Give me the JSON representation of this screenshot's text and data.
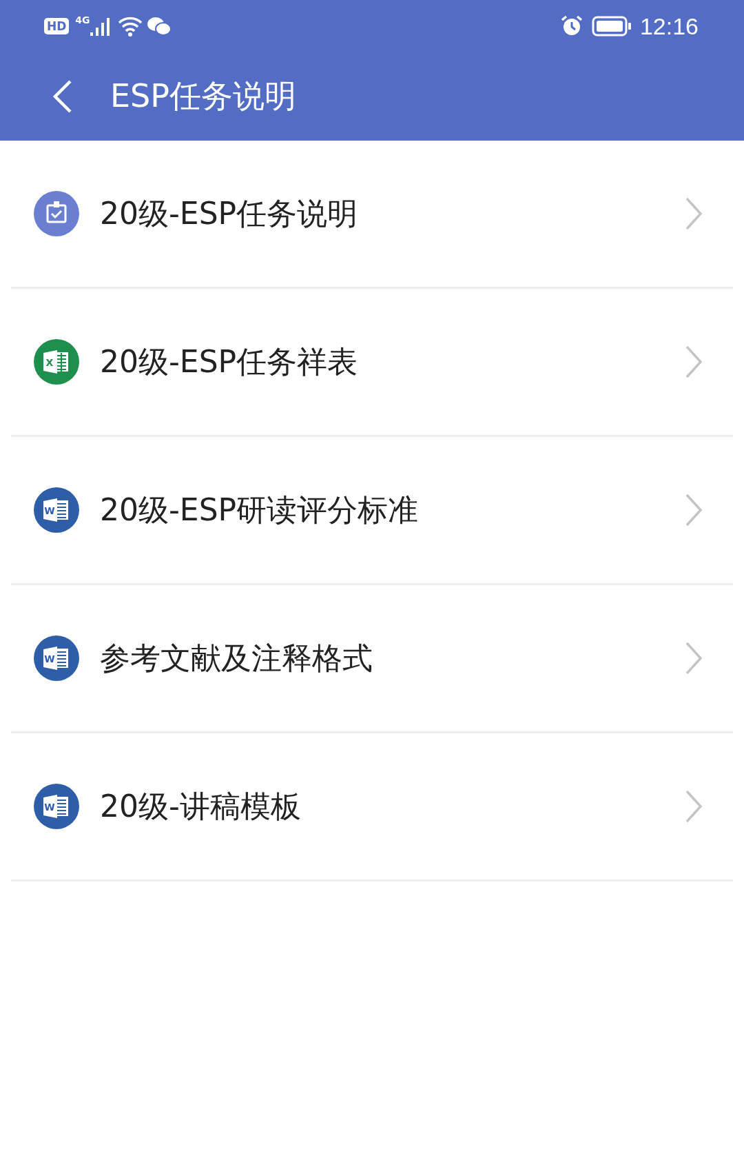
{
  "status_bar": {
    "hd": "HD",
    "network": "4G",
    "time": "12:16"
  },
  "header": {
    "title": "ESP任务说明"
  },
  "items": [
    {
      "kind": "task",
      "label": "20级-ESP任务说明"
    },
    {
      "kind": "excel",
      "icon_letter": "X",
      "label": "20级-ESP任务祥表"
    },
    {
      "kind": "word",
      "icon_letter": "W",
      "label": "20级-ESP研读评分标准"
    },
    {
      "kind": "word",
      "icon_letter": "W",
      "label": "参考文献及注释格式"
    },
    {
      "kind": "word",
      "icon_letter": "W",
      "label": "20级-讲稿模板"
    }
  ]
}
